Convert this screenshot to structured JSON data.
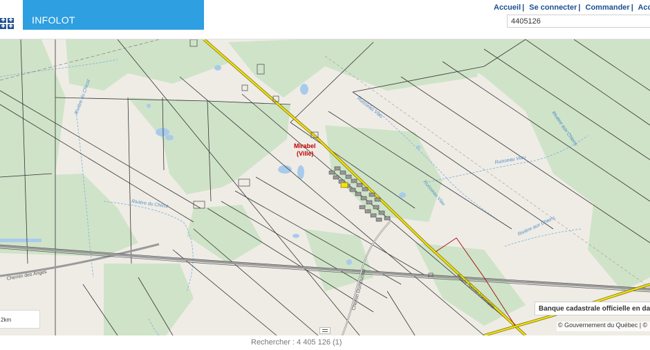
{
  "header": {
    "brand": "INFOLOT",
    "logo_icon": "quebec-flag-icon",
    "nav": [
      {
        "label": "Accueil",
        "sep": "|"
      },
      {
        "label": "Se connecter",
        "sep": "|"
      },
      {
        "label": "Commander",
        "sep": "|"
      },
      {
        "label": "Accessibi",
        "sep": ""
      }
    ],
    "search_value": "4405126"
  },
  "map": {
    "place_name_line1": "Mirabel",
    "place_name_line2": "(Ville)",
    "streams": [
      "Ruisseau Viau",
      "Ruisseau Viau",
      "Ruisseau Viau",
      "Rivière du Chicot",
      "Rivière du Chicot",
      "Rivière aux Chiens",
      "Rivière aux Chiens"
    ],
    "roads": [
      "Route Sainte-Henriette",
      "Chemin Dumouchel",
      "Chemin des Anges"
    ],
    "scale_label": "2km",
    "cadastre_label": "Banque cadastrale officielle en date",
    "copyright": "© Gouvernement du Québec | ©",
    "highlight_color": "#f2e600",
    "accent_color": "#2e9fe0"
  },
  "footer": {
    "result": "Rechercher : 4 405 126 (1)"
  }
}
